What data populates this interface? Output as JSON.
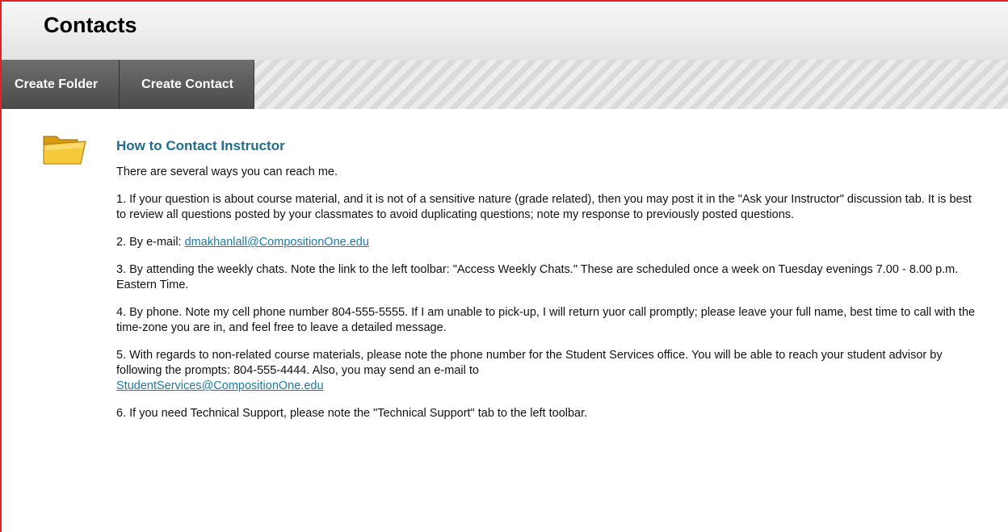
{
  "page": {
    "title": "Contacts"
  },
  "toolbar": {
    "create_folder_label": "Create Folder",
    "create_contact_label": "Create Contact"
  },
  "item": {
    "icon": "folder-icon",
    "title": "How to Contact Instructor",
    "intro": "There are several ways you can reach me.",
    "p1": "1. If your question is about course material, and it is not of a sensitive nature (grade related), then you may post it in the \"Ask your Instructor\" discussion tab. It is best to review all questions posted by your classmates to avoid duplicating questions; note my response to previously posted questions.",
    "p2_prefix": "2. By e-mail: ",
    "p2_email": "dmakhanlall@CompositionOne.edu",
    "p3": "3. By attending the weekly chats.  Note the link to the left toolbar: \"Access Weekly Chats.\"  These are scheduled once a week on Tuesday evenings 7.00 - 8.00 p.m. Eastern Time.",
    "p4": "4. By phone.  Note my cell phone number 804-555-5555.  If I am unable to pick-up, I will return yuor call promptly; please leave your full name, best time to call with the time-zone you are in, and feel free to leave a detailed message.",
    "p5_text": "5. With regards to non-related course materials, please note the phone number for the Student Services office.  You will be able to reach your student advisor by following the prompts: 804-555-4444.  Also, you may send an e-mail to",
    "p5_email": "StudentServices@CompositionOne.edu",
    "p6": "6. If you need Technical Support, please note the \"Technical Support\" tab to the left toolbar."
  },
  "colors": {
    "accent_title": "#1d6d8c",
    "link": "#1f7aa1",
    "frame_border": "#e02424",
    "toolbar_button": "#5a5a5a"
  }
}
